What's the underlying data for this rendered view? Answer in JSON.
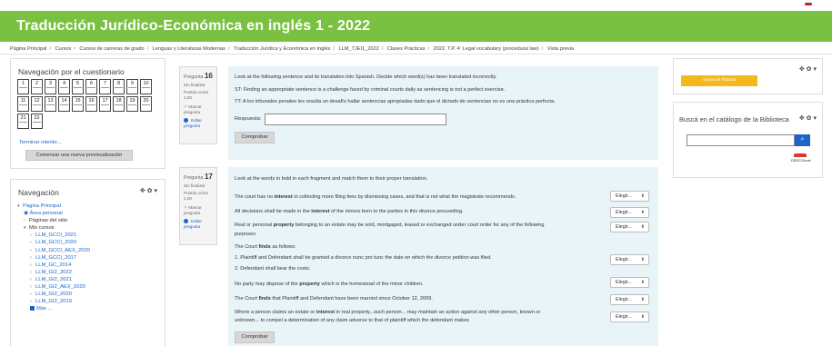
{
  "header": {
    "title": "Traducción Jurídico-Económica en inglés 1 - 2022"
  },
  "breadcrumb": [
    "Página Principal",
    "Cursos",
    "Cursos de carreras de grado",
    "Lenguas y Literaturas Modernas",
    "Traducción Jurídica y Económica en Inglés",
    "LLM_TJEI1_2022",
    "Clases Prácticas",
    "2022. T.P. 4: Legal vocabulary (procedural law)",
    "Vista previa"
  ],
  "quiz_nav": {
    "title": "Navegación por el cuestionario",
    "questions": [
      "1",
      "2",
      "3",
      "4",
      "5",
      "6",
      "7",
      "8",
      "9",
      "10",
      "11",
      "12",
      "13",
      "14",
      "15",
      "16",
      "17",
      "18",
      "19",
      "20",
      "21",
      "22"
    ],
    "finish_label": "Terminar intento...",
    "new_preview_label": "Comenzar una nueva previsualización"
  },
  "navigation": {
    "title": "Navegación",
    "controls": "✥ ✿ ▾",
    "items": [
      "Página Principal",
      "Área personal",
      "Páginas del sitio",
      "Mis cursos",
      "LLM_GCCI_2021",
      "LLM_GCCI_2020",
      "LLM_GCCI_AEX_2020",
      "LLM_GCCI_2017",
      "LLM_GC_2014",
      "LLM_GI2_2022",
      "LLM_GI2_2021",
      "LLM_GI2_AEX_2020",
      "LLM_GI2_2020",
      "LLM_GI2_2019",
      "Más ..."
    ]
  },
  "question16": {
    "label": "Pregunta",
    "number": "16",
    "state": "Sin finalizar",
    "mark_line1": "Puntúa como",
    "mark_line2": "1,00",
    "flag_line1": "Marcar",
    "flag_line2": "pregunta",
    "edit_line1": "Editar",
    "edit_line2": "pregunta",
    "text1": "Look at the following sentence and its translation into Spanish. Decide which word(s) has been translated incorrectly.",
    "text2": "ST: Finding an appropriate sentence is a challenge faced by criminal courts daily as sentencing is not a perfect exercise.",
    "text3": "TT: A los tribunales penales les resulta un desafío hallar sentencias apropiadas dado que el dictado de sentencias no es una práctica perfecta.",
    "answer_label": "Respuesta:",
    "check_label": "Comprobar"
  },
  "question17": {
    "label": "Pregunta",
    "number": "17",
    "state": "Sin finalizar",
    "mark_line1": "Puntúa como",
    "mark_line2": "1,00",
    "flag_line1": "Marcar",
    "flag_line2": "pregunta",
    "edit_line1": "Editar",
    "edit_line2": "pregunta",
    "intro": "Look at the words in bold in each fragment and match them to their proper translation.",
    "select_label": "Elegir...",
    "check_label": "Comprobar",
    "rows": [
      {
        "pre": "The court has no ",
        "bold": "interest",
        "post": " in collecting more filing fees by dismissing cases, and that is not what the magistrate recommends."
      },
      {
        "pre": "All decisions shall be made in the ",
        "bold": "interest",
        "post": " of the minors born to the parties in this divorce proceeding."
      },
      {
        "pre": "Real or personal ",
        "bold": "property",
        "post": " belonging to an estate may be sold, mortgaged, leased or exchanged under court order for any of the following"
      },
      {
        "pre": "purposes",
        "bold": "",
        "post": ""
      },
      {
        "pre": "The Court ",
        "bold": "finds",
        "post": " as follows:"
      },
      {
        "pre": "1. Plaintiff and Defendant shall be granted a divorce nunc pro tunc the date on which the divorce petition was filed.",
        "bold": "",
        "post": ""
      },
      {
        "pre": "2. Defendant shall bear the costs.",
        "bold": "",
        "post": ""
      },
      {
        "pre": "No party may dispose of the ",
        "bold": "property",
        "post": " which is the homestead of the minor children."
      },
      {
        "pre": "The Court ",
        "bold": "finds",
        "post": " that Plaintiff and Defendant have been married since October 12, 2009."
      },
      {
        "pre": "Where a person claims an estate or ",
        "bold": "interest",
        "post": " in real property...such person... may maintain an action against any other person, known or"
      },
      {
        "pre": "unknown... to compel a determination of any claim adverse to that of plaintiff which the defendant makes",
        "bold": "",
        "post": ""
      }
    ]
  },
  "right_blocks": {
    "controls": "✥ ✿ ▾",
    "ajax_label": "Ajalas de filtados",
    "catalog_title": "Buscá en el catálogo de la Biblioteca",
    "search_icon": "search-icon",
    "ebsco_text": "EBSCOhost"
  },
  "colors": {
    "header_green": "#7ac142",
    "link_blue": "#1e64c8",
    "question_bg": "#e8f4f8",
    "ajax_yellow": "#f4b81c"
  }
}
